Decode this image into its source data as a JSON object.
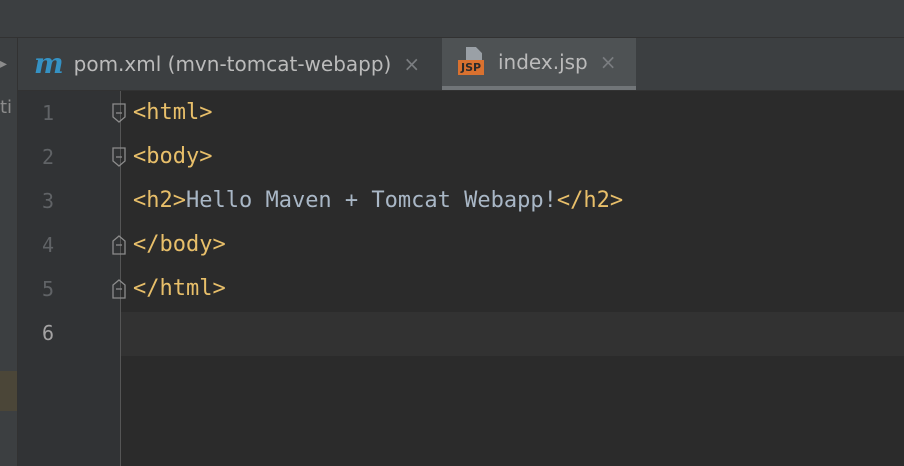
{
  "window": {
    "left_strip_text": "ti",
    "left_strip_arrow": "▸"
  },
  "tabs": [
    {
      "label": "pom.xml (mvn-tomcat-webapp)",
      "icon": "maven-icon",
      "icon_glyph": "m",
      "active": false,
      "close": "×"
    },
    {
      "label": "index.jsp",
      "icon": "jsp-file-icon",
      "icon_badge": "JSP",
      "active": true,
      "close": "×"
    }
  ],
  "editor": {
    "current_line": 6,
    "lines": [
      {
        "number": "1",
        "segments": [
          {
            "kind": "tag",
            "text": "<html>"
          }
        ]
      },
      {
        "number": "2",
        "segments": [
          {
            "kind": "tag",
            "text": "<body>"
          }
        ]
      },
      {
        "number": "3",
        "segments": [
          {
            "kind": "tag",
            "text": "<h2>"
          },
          {
            "kind": "text",
            "text": "Hello Maven + Tomcat Webapp!"
          },
          {
            "kind": "tag",
            "text": "</h2>"
          }
        ]
      },
      {
        "number": "4",
        "segments": [
          {
            "kind": "tag",
            "text": "</body>"
          }
        ]
      },
      {
        "number": "5",
        "segments": [
          {
            "kind": "tag",
            "text": "</html>"
          }
        ]
      },
      {
        "number": "6",
        "segments": []
      }
    ]
  },
  "colors": {
    "tag": "#e8bf6a",
    "text": "#a9b7c6",
    "maven_icon": "#3592c4",
    "jsp_badge": "#d9712f"
  }
}
